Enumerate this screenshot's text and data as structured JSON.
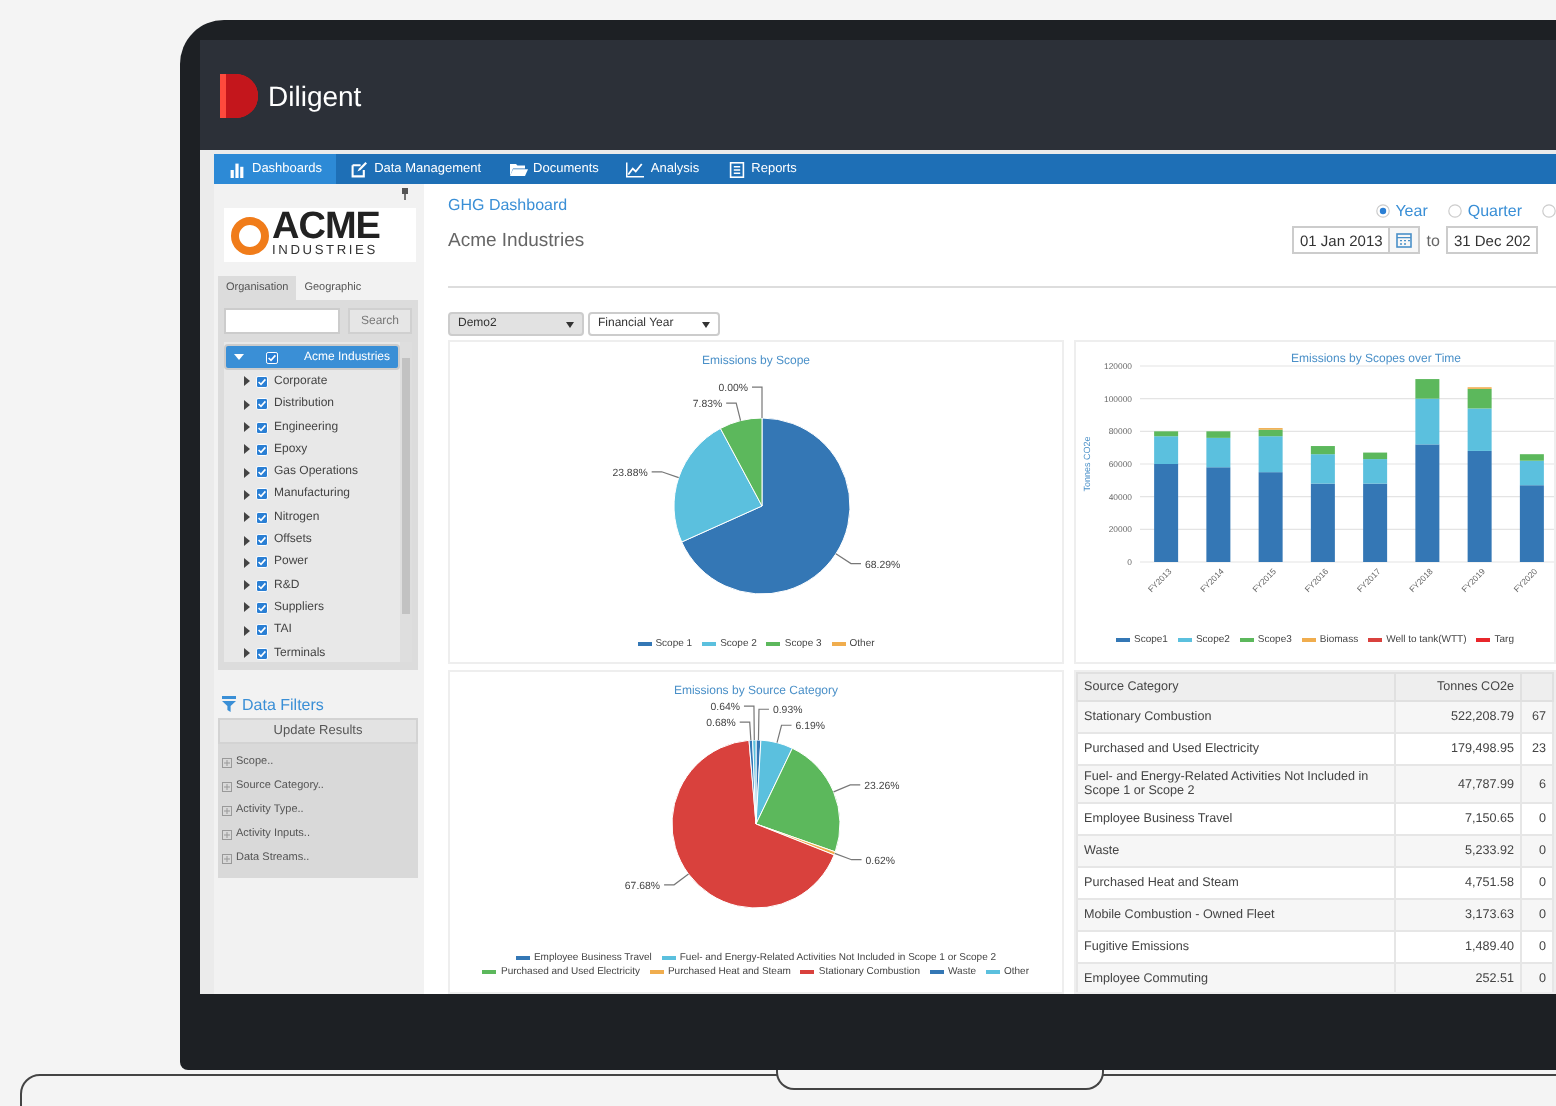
{
  "brand": {
    "name": "Diligent"
  },
  "nav": [
    {
      "label": "Dashboards",
      "selected": true
    },
    {
      "label": "Data Management",
      "selected": false
    },
    {
      "label": "Documents",
      "selected": false
    },
    {
      "label": "Analysis",
      "selected": false
    },
    {
      "label": "Reports",
      "selected": false
    }
  ],
  "sidebar": {
    "logo": {
      "name": "ACME",
      "tagline": "INDUSTRIES"
    },
    "tabs": [
      {
        "label": "Organisation",
        "selected": true
      },
      {
        "label": "Geographic",
        "selected": false
      }
    ],
    "search": {
      "button": "Search"
    },
    "tree": [
      {
        "label": "Acme Industries",
        "checked": true,
        "selected": true,
        "expanded": true,
        "children": [
          {
            "label": "Corporate",
            "checked": true,
            "selected": false,
            "expanded": false
          },
          {
            "label": "Distribution",
            "checked": true,
            "selected": false,
            "expanded": false
          },
          {
            "label": "Engineering",
            "checked": true,
            "selected": false,
            "expanded": false
          },
          {
            "label": "Epoxy",
            "checked": true,
            "selected": false,
            "expanded": false
          },
          {
            "label": "Gas Operations",
            "checked": true,
            "selected": false,
            "expanded": false
          },
          {
            "label": "Manufacturing",
            "checked": true,
            "selected": false,
            "expanded": false
          },
          {
            "label": "Nitrogen",
            "checked": true,
            "selected": false,
            "expanded": false
          },
          {
            "label": "Offsets",
            "checked": true,
            "selected": false,
            "expanded": false
          },
          {
            "label": "Power",
            "checked": true,
            "selected": false,
            "expanded": false
          },
          {
            "label": "R&D",
            "checked": true,
            "selected": false,
            "expanded": false
          },
          {
            "label": "Suppliers",
            "checked": true,
            "selected": false,
            "expanded": false
          },
          {
            "label": "TAI",
            "checked": true,
            "selected": false,
            "expanded": false
          },
          {
            "label": "Terminals",
            "checked": true,
            "selected": false,
            "expanded": false
          }
        ]
      }
    ],
    "filters": {
      "title": "Data Filters",
      "button": "Update Results",
      "items": [
        "Scope..",
        "Source Category..",
        "Activity Type..",
        "Activity Inputs..",
        "Data Streams.."
      ]
    }
  },
  "header": {
    "breadcrumb": "GHG Dashboard",
    "title": "Acme Industries"
  },
  "period": [
    {
      "label": "Year",
      "selected": true
    },
    {
      "label": "Quarter",
      "selected": false
    },
    {
      "selected": false
    }
  ],
  "date_range": {
    "from": "01 Jan 2013",
    "separator": "to",
    "to": "31 Dec 202"
  },
  "selects": [
    {
      "value": "Demo2",
      "disabled": true
    },
    {
      "value": "Financial Year",
      "disabled": false
    }
  ],
  "scope_pie": {
    "chart_data": {
      "type": "pie",
      "title": "Emissions by Scope",
      "categories": [
        "Scope 1",
        "Scope 2",
        "Scope 3",
        "Other"
      ],
      "values": [
        68.29,
        23.88,
        7.83,
        0.0
      ],
      "value_labels": [
        "68.29%",
        "23.88%",
        "7.83%",
        "0.00%"
      ],
      "legend": true
    }
  },
  "scope_trend": {
    "chart_data": {
      "type": "bar",
      "stacked": true,
      "title": "Emissions by Scopes over Time",
      "ylabel": "Tonnes CO2e",
      "categories": [
        "FY2013",
        "FY2014",
        "FY2015",
        "FY2016",
        "FY2017",
        "FY2018",
        "FY2019",
        "FY2020"
      ],
      "ylim": [
        0,
        120000
      ],
      "grid": true,
      "legend": true,
      "yticks": [
        0,
        20000,
        40000,
        60000,
        80000,
        100000,
        120000
      ],
      "series": [
        {
          "name": "Scope1",
          "color": "#3477b5",
          "values": [
            60000,
            58000,
            55000,
            48000,
            48000,
            72000,
            68000,
            47000
          ]
        },
        {
          "name": "Scope2",
          "color": "#5bc0de",
          "values": [
            17000,
            18000,
            22000,
            18000,
            15000,
            28000,
            26000,
            15000
          ]
        },
        {
          "name": "Scope3",
          "color": "#5cb85c",
          "values": [
            3000,
            4000,
            4000,
            5000,
            4000,
            12000,
            12000,
            4000
          ]
        },
        {
          "name": "Biomass",
          "color": "#f0ad4e",
          "values": [
            0,
            0,
            1000,
            0,
            0,
            0,
            1000,
            0
          ]
        },
        {
          "name": "Well to tank(WTT)",
          "color": "#d9413d",
          "values": [
            null,
            null,
            null,
            null,
            null,
            null,
            null,
            null
          ]
        },
        {
          "name": "Targ",
          "color": "#e8262b",
          "values": [
            null,
            null,
            null,
            null,
            null,
            null,
            null,
            null
          ]
        }
      ]
    }
  },
  "source_pie": {
    "chart_data": {
      "type": "pie",
      "title": "Emissions by Source Category",
      "categories": [
        "Employee Business Travel",
        "Fuel- and Energy-Related Activities Not Included in Scope 1 or Scope 2",
        "Purchased and Used Electricity",
        "Purchased Heat and Steam",
        "Stationary Combustion",
        "Waste",
        "Other"
      ],
      "values": [
        0.93,
        6.19,
        23.26,
        0.62,
        67.68,
        0.68,
        0.64
      ],
      "value_labels": [
        "0.93%",
        "6.19%",
        "23.26%",
        "0.62%",
        "67.68%",
        "0.68%",
        "0.64%"
      ],
      "legend": true
    }
  },
  "source_table": {
    "columns": [
      "Source Category",
      "Tonnes CO2e"
    ],
    "rows": [
      [
        "Stationary Combustion",
        "522,208.79",
        "67"
      ],
      [
        "Purchased and Used Electricity",
        "179,498.95",
        "23"
      ],
      [
        "Fuel- and Energy-Related Activities Not Included in Scope 1 or Scope 2",
        "47,787.99",
        "6"
      ],
      [
        "Employee Business Travel",
        "7,150.65",
        "0"
      ],
      [
        "Waste",
        "5,233.92",
        "0"
      ],
      [
        "Purchased Heat and Steam",
        "4,751.58",
        "0"
      ],
      [
        "Mobile Combustion - Owned Fleet",
        "3,173.63",
        "0"
      ],
      [
        "Fugitive Emissions",
        "1,489.40",
        "0"
      ],
      [
        "Employee Commuting",
        "252.51",
        "0"
      ]
    ]
  }
}
